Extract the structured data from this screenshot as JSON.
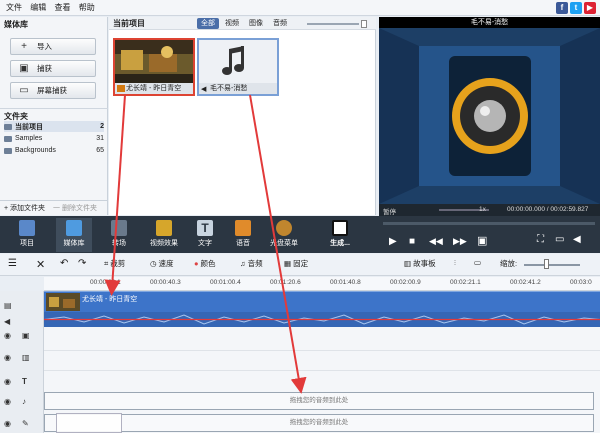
{
  "menubar": {
    "items": [
      "文件",
      "编辑",
      "查看",
      "帮助"
    ]
  },
  "library": {
    "title": "媒体库",
    "buttons": [
      {
        "label": "导入",
        "icon": "plus-icon",
        "glyph": "+"
      },
      {
        "label": "捕获",
        "icon": "camera-icon",
        "glyph": "▣"
      },
      {
        "label": "屏幕捕获",
        "icon": "monitor-icon",
        "glyph": "▭"
      }
    ],
    "folders_title": "文件夹",
    "folders": [
      {
        "name": "当前项目",
        "count": "2"
      },
      {
        "name": "Samples",
        "count": "31"
      },
      {
        "name": "Backgrounds",
        "count": "65"
      }
    ],
    "add_folder": "+ 添加文件夹",
    "delete_folder": "一 删除文件夹"
  },
  "media": {
    "title": "当前项目",
    "tabs": [
      "全部",
      "视频",
      "图像",
      "音频"
    ],
    "items": [
      {
        "caption": "尤长靖 - 昨日青空",
        "type": "video"
      },
      {
        "caption": "毛不易-消愁",
        "type": "audio"
      }
    ]
  },
  "preview": {
    "title": "毛不易-消愁",
    "status": "暂停",
    "speed": "1x",
    "time": "00:00:00.000 / 00:02:59.827"
  },
  "toolbar": {
    "items": [
      {
        "label": "项目",
        "color": "#5a88c9"
      },
      {
        "label": "媒体库",
        "color": "#4f9be0"
      },
      {
        "label": "转场",
        "color": "#6a7a8c"
      },
      {
        "label": "视频效果",
        "color": "#d6a62b"
      },
      {
        "label": "文字",
        "color": "#c8d4e0"
      },
      {
        "label": "语音",
        "color": "#e08b2b"
      },
      {
        "label": "光盘菜单",
        "color": "#c0862e"
      },
      {
        "label": "生成...",
        "color": "#2f3a45"
      }
    ]
  },
  "timeline_tools": {
    "crop": "裁剪",
    "speed": "速度",
    "color": "颜色",
    "audio": "音频",
    "fix": "固定",
    "storyboard": "故事板",
    "zoom": "缩放:"
  },
  "ruler": [
    "00:00:20.1",
    "00:00:40.3",
    "00:01:00.4",
    "00:01:20.6",
    "00:01:40.8",
    "00:02:00.9",
    "00:02:21.1",
    "00:02:41.2",
    "00:03:0"
  ],
  "tracks": {
    "clip_label": "尤长靖 - 昨日青空",
    "dropzone1": "拖拽您的音频到此处",
    "dropzone2": "拖拽您的音频到此处"
  },
  "colors": {
    "accent": "#4a6ea8",
    "arrow": "#e23a3a",
    "clip": "#3d74c9"
  }
}
